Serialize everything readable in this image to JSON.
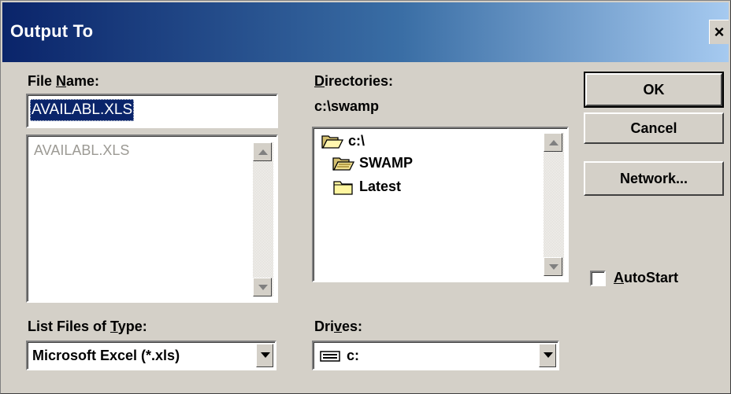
{
  "window": {
    "title": "Output To",
    "close_glyph": "×"
  },
  "file_name": {
    "label_pre": "File ",
    "label_ul": "N",
    "label_post": "ame:",
    "value": "AVAILABL.XLS",
    "list_items": [
      "AVAILABL.XLS"
    ]
  },
  "directories": {
    "label_ul": "D",
    "label_post": "irectories:",
    "current_path": "c:\\swamp",
    "items": [
      {
        "name": "c:\\",
        "icon": "folder-open-icon"
      },
      {
        "name": "SWAMP",
        "icon": "folder-open-icon"
      },
      {
        "name": "Latest",
        "icon": "folder-closed-icon"
      }
    ]
  },
  "file_type": {
    "label_pre": "List Files of ",
    "label_ul": "T",
    "label_post": "ype:",
    "selected": "Microsoft Excel (*.xls)"
  },
  "drives": {
    "label_pre": "Dri",
    "label_ul": "v",
    "label_post": "es:",
    "selected": "c:",
    "icon": "drive-icon"
  },
  "buttons": {
    "ok": "OK",
    "cancel": "Cancel",
    "network": "Network..."
  },
  "autostart": {
    "label_ul": "A",
    "label_post": "utoStart",
    "checked": false
  },
  "colors": {
    "face": "#d4d0c8",
    "title_start": "#0a246a",
    "title_end": "#a6caf0",
    "selection": "#0a246a"
  }
}
